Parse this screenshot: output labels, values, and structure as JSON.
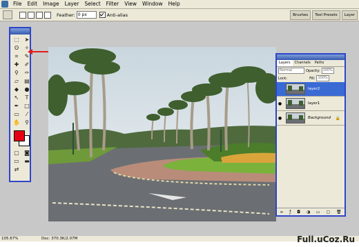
{
  "menu": [
    "File",
    "Edit",
    "Image",
    "Layer",
    "Select",
    "Filter",
    "View",
    "Window",
    "Help"
  ],
  "options": {
    "feather_label": "Feather:",
    "feather_value": "0 px",
    "antialias_label": "Anti-alias"
  },
  "palette_well": [
    "Brushes",
    "Tool Presets",
    "Layer"
  ],
  "tools": [
    "marquee-tool",
    "move-tool",
    "lasso-tool",
    "magic-wand-tool",
    "crop-tool",
    "slice-tool",
    "healing-brush-tool",
    "brush-tool",
    "clone-stamp-tool",
    "history-brush-tool",
    "eraser-tool",
    "gradient-tool",
    "blur-tool",
    "dodge-tool",
    "path-selection-tool",
    "type-tool",
    "pen-tool",
    "shape-tool",
    "notes-tool",
    "eyedropper-tool",
    "hand-tool",
    "zoom-tool"
  ],
  "colors": {
    "foreground": "#e60014",
    "background": "#ffffff",
    "accent": "#2d44c8",
    "arrow": "#e21c1c"
  },
  "layers_panel": {
    "tabs": [
      "Layers",
      "Channels",
      "Paths"
    ],
    "blend_mode": "Normal",
    "opacity_label": "Opacity:",
    "opacity_value": "100%",
    "lock_label": "Lock:",
    "fill_label": "Fill:",
    "fill_value": "100%",
    "layers": [
      {
        "name": "layer2",
        "selected": true,
        "visible": false
      },
      {
        "name": "layer1",
        "selected": false,
        "visible": true
      },
      {
        "name": "Background",
        "selected": false,
        "visible": true,
        "locked": true
      }
    ]
  },
  "status": {
    "zoom": "105.67%",
    "doc": "Doc: 370.3K/2.07M"
  },
  "watermark": "Full.uCoz.Ru"
}
